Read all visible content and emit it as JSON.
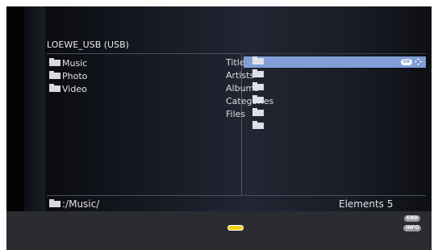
{
  "header": {
    "title": "LOEWE_USB (USB)"
  },
  "left_list": [
    {
      "label": "Music",
      "icon": "folder-icon"
    },
    {
      "label": "Photo",
      "icon": "folder-icon"
    },
    {
      "label": "Video",
      "icon": "folder-icon"
    }
  ],
  "middle_list": [
    {
      "label": "Titles"
    },
    {
      "label": "Artists"
    },
    {
      "label": "Albums"
    },
    {
      "label": "Categories"
    },
    {
      "label": "Files"
    }
  ],
  "selection": {
    "ok_badge": "OK",
    "nav_icon": "dpad-icon"
  },
  "footer": {
    "path": ":/Music/",
    "elements": "Elements 5",
    "end_button": "END",
    "info_button": "INFO",
    "yellow_key": "yellow-key",
    "colors": {
      "yellow": "#f2d21c",
      "selection": "#7f9fd6"
    }
  }
}
